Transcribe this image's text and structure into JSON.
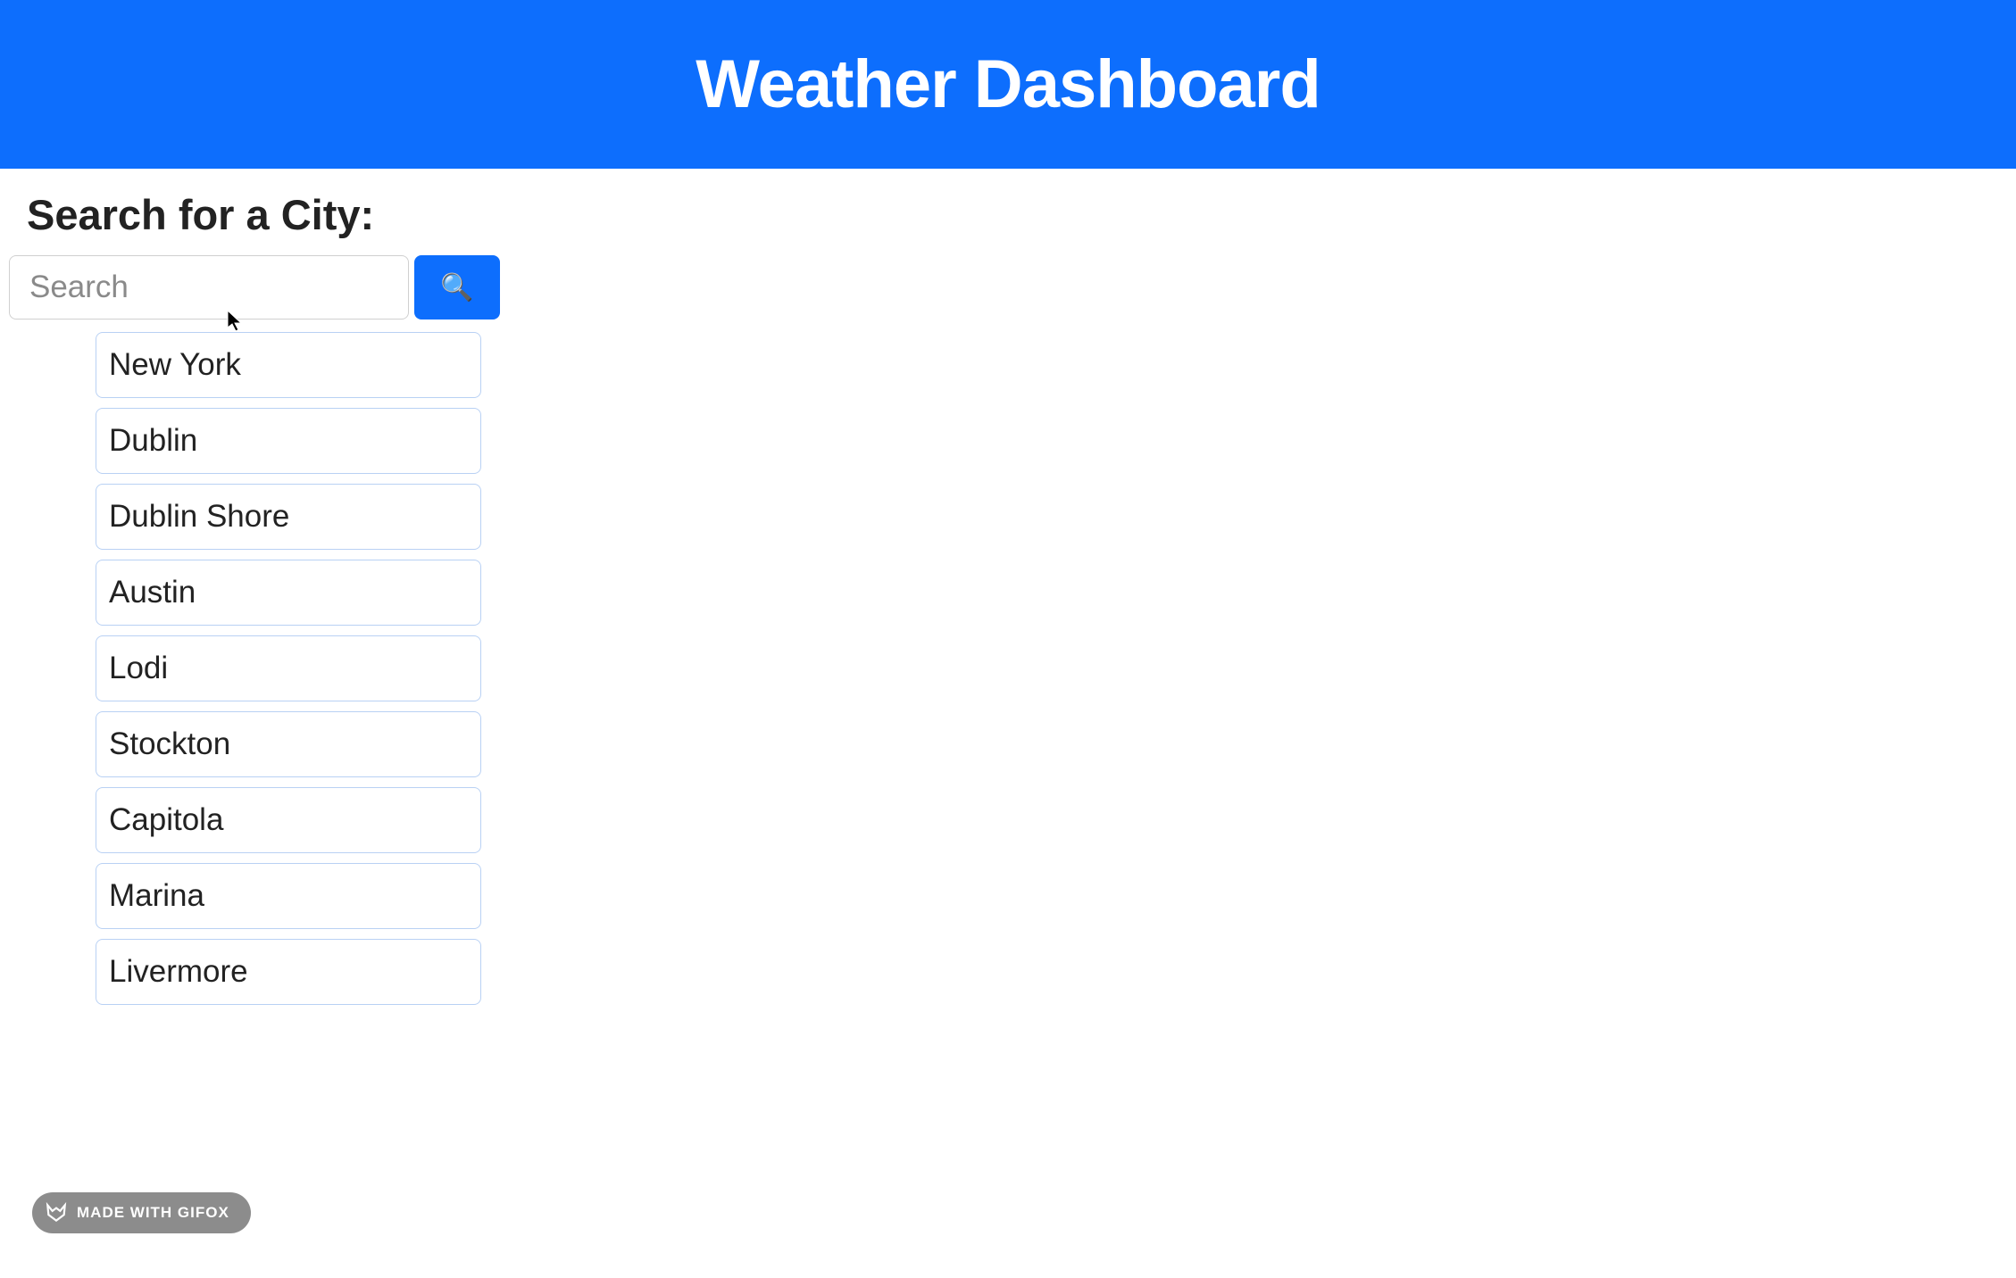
{
  "header": {
    "title": "Weather Dashboard"
  },
  "search": {
    "label": "Search for a City:",
    "placeholder": "Search",
    "icon": "🔍"
  },
  "cities": [
    "New York",
    "Dublin",
    "Dublin Shore",
    "Austin",
    "Lodi",
    "Stockton",
    "Capitola",
    "Marina",
    "Livermore"
  ],
  "watermark": {
    "text": "MADE WITH GIFOX"
  }
}
